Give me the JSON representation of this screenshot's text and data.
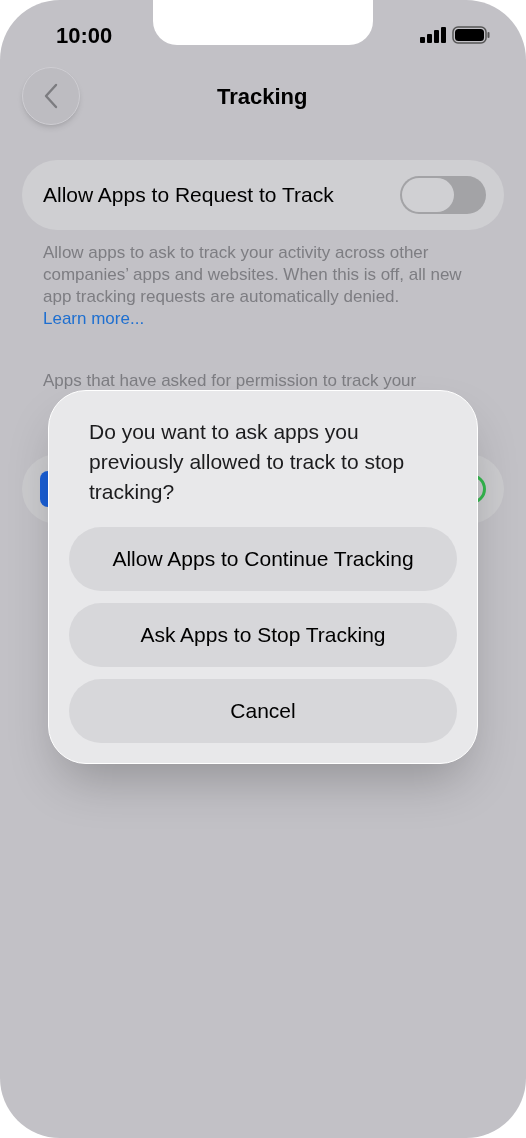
{
  "status_bar": {
    "time": "10:00"
  },
  "nav": {
    "title": "Tracking"
  },
  "setting": {
    "label": "Allow Apps to Request to Track",
    "on": false
  },
  "footnote": {
    "text": "Allow apps to ask to track your activity across other companies’ apps and websites. When this is off, all new app tracking requests are automatically denied.",
    "link": "Learn more..."
  },
  "section_note": {
    "lines": [
      "Apps that have asked for permission to track your"
    ]
  },
  "alert": {
    "message": "Do you want to ask apps you previously allowed to track to stop tracking?",
    "actions": [
      "Allow Apps to Continue Tracking",
      "Ask Apps to Stop Tracking",
      "Cancel"
    ]
  }
}
